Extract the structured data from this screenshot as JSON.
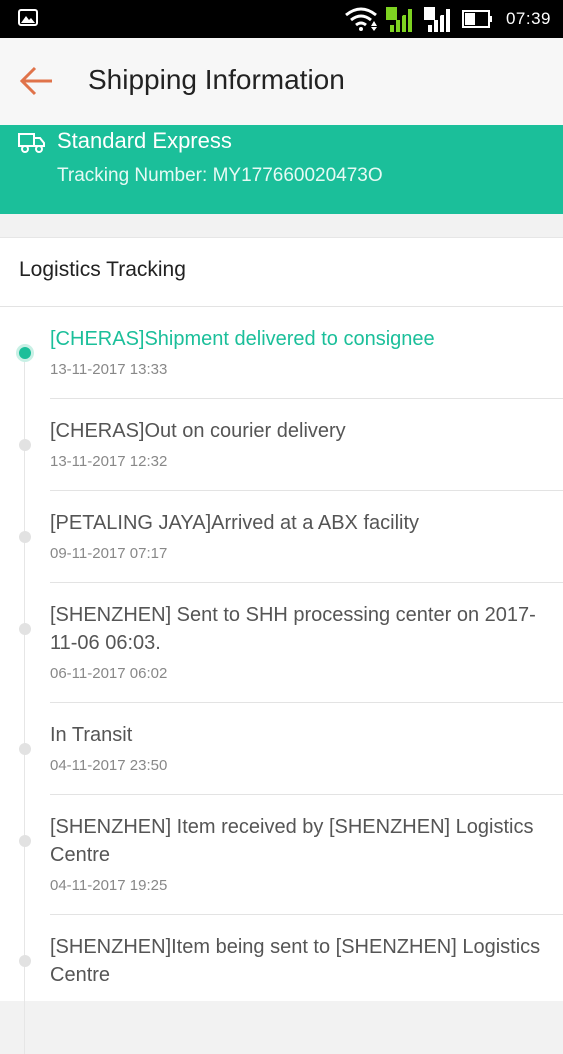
{
  "status_bar": {
    "time": "07:39",
    "sim1": "1",
    "sim2": "2"
  },
  "header": {
    "title": "Shipping Information"
  },
  "shipment": {
    "method": "Standard Express",
    "tracking": "Tracking Number: MY177660020473O"
  },
  "logistics": {
    "title": "Logistics Tracking",
    "events": [
      {
        "message": "[CHERAS]Shipment delivered to consignee",
        "time": "13-11-2017 13:33"
      },
      {
        "message": "[CHERAS]Out on courier delivery",
        "time": "13-11-2017 12:32"
      },
      {
        "message": "[PETALING JAYA]Arrived at a ABX facility",
        "time": "09-11-2017 07:17"
      },
      {
        "message": "[SHENZHEN] Sent to SHH processing center on 2017-11-06 06:03.",
        "time": "06-11-2017 06:02"
      },
      {
        "message": "In Transit",
        "time": "04-11-2017 23:50"
      },
      {
        "message": "[SHENZHEN] Item received by [SHENZHEN] Logistics Centre",
        "time": "04-11-2017 19:25"
      },
      {
        "message": "[SHENZHEN]Item being sent to [SHENZHEN] Logistics Centre",
        "time": ""
      }
    ]
  },
  "colors": {
    "accent": "#1bbf9a",
    "back_arrow": "#e0734a"
  }
}
